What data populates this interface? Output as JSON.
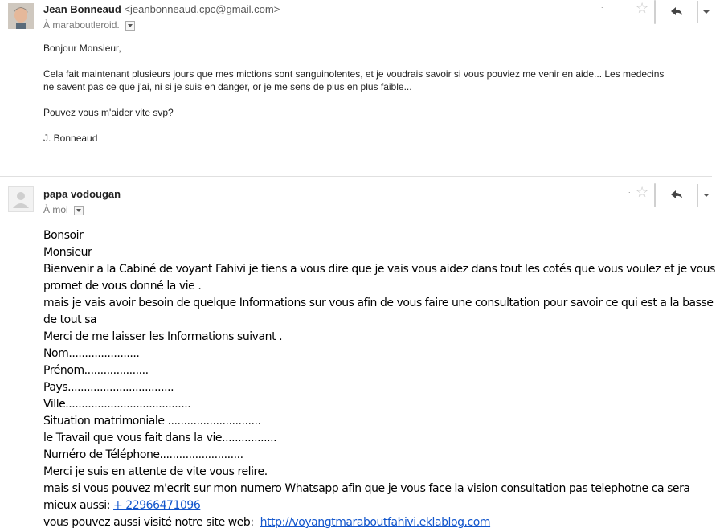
{
  "message1": {
    "sender_name": "Jean Bonneaud",
    "sender_email": "<jeanbonneaud.cpc@gmail.com>",
    "recipient": "À maraboutleroid.",
    "greeting": "Bonjour Monsieur,",
    "paragraph1": "Cela fait maintenant plusieurs jours que mes mictions sont sanguinolentes, et je voudrais savoir si vous pouviez me venir en aide... Les medecins ne savent pas ce que j'ai, ni si je suis en danger, or je me sens de plus en plus faible...",
    "paragraph2": "Pouvez vous m'aider vite svp?",
    "signature": "J. Bonneaud"
  },
  "message2": {
    "sender_name": "papa vodougan",
    "recipient": "À moi",
    "lines": [
      "Bonsoir",
      "Monsieur",
      "Bienvenir a la Cabiné de voyant Fahivi je tiens a vous dire que je vais vous aidez dans tout les cotés que vous voulez et je vous promet de vous donné la vie .",
      "mais je vais avoir besoin de quelque Informations sur vous afin de vous faire une consultation pour savoir ce qui est a la basse de tout sa",
      "Merci de me laisser les Informations suivant .",
      "Nom......................",
      "Prénom....................",
      "Pays.................................",
      "Ville.......................................",
      "Situation matrimoniale .............................",
      "le Travail que vous fait dans la vie.................",
      "Numéro de Téléphone..........................",
      "Merci je suis en attente de vite vous relire.",
      "mais si vous pouvez m'ecrit sur mon numero Whatsapp afin que je vous face la vision consultation pas telephotne ca sera mieux aussi:"
    ],
    "phone": "+ 22966471096",
    "website_label": "vous pouvez aussi visité notre site web:",
    "website_url": "http://voyangtmaraboutfahivi.eklablog.com"
  },
  "icons": [
    "star-icon",
    "reply-icon",
    "more-options-icon",
    "dropdown-icon",
    "avatar-icon"
  ]
}
